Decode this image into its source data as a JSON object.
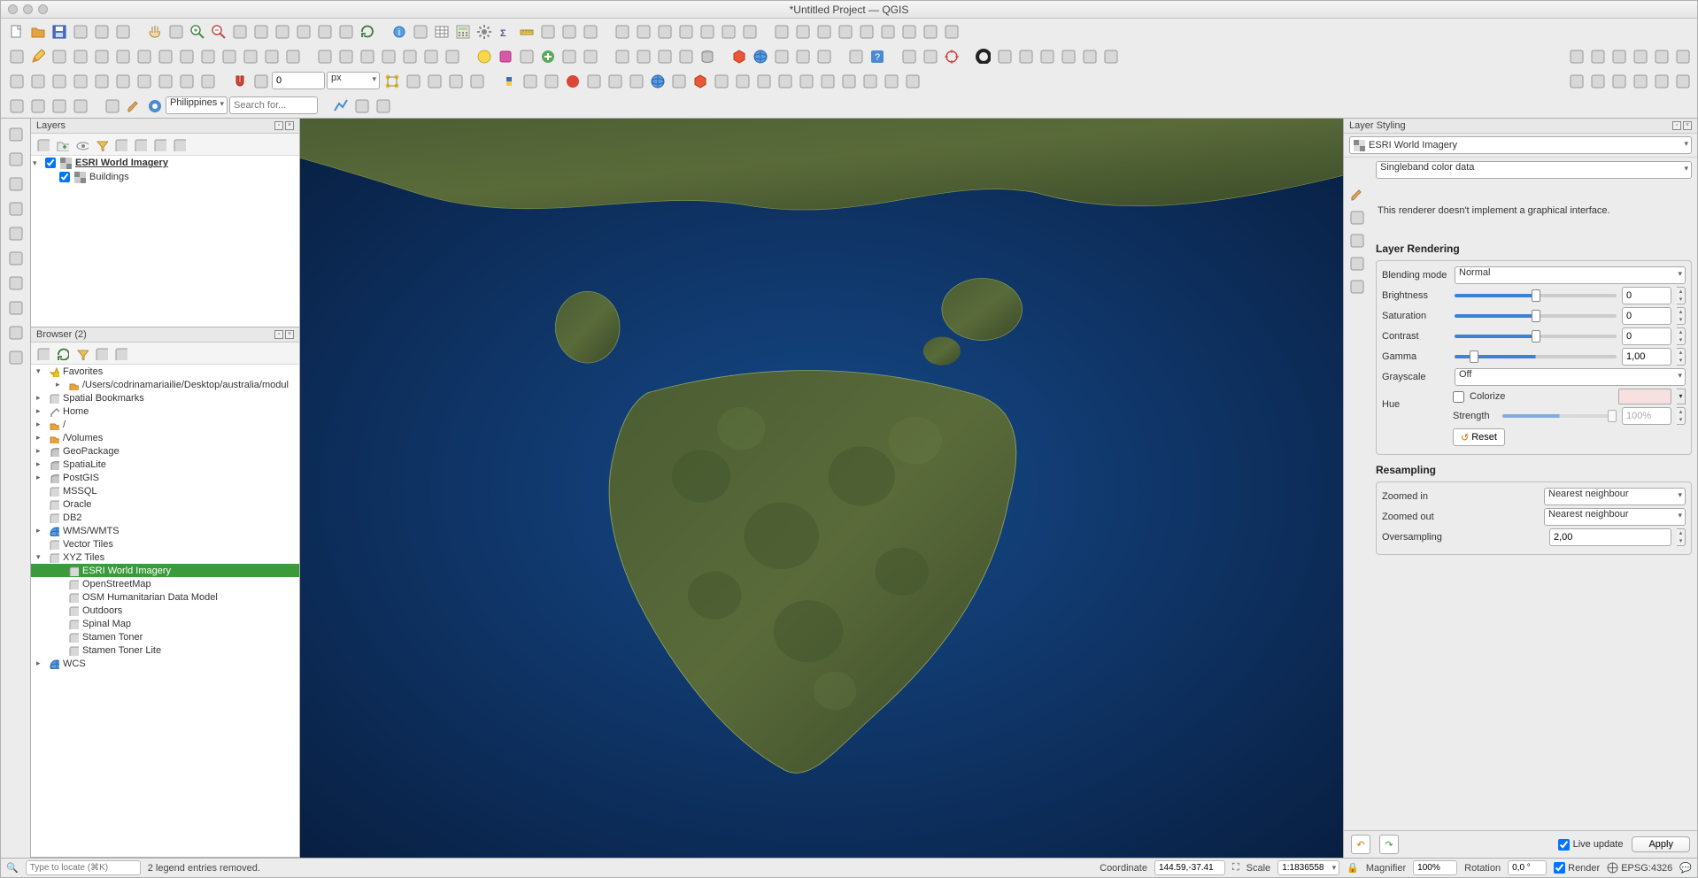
{
  "window": {
    "title": "*Untitled Project — QGIS"
  },
  "toolbar4": {
    "search_placeholder": "Search for...",
    "region": "Philippines",
    "number": "0",
    "unit": "px"
  },
  "layers_panel": {
    "title": "Layers",
    "items": [
      {
        "name": "ESRI World Imagery",
        "checked": true,
        "bold": true
      },
      {
        "name": "Buildings",
        "checked": true,
        "bold": false
      }
    ]
  },
  "browser_panel": {
    "title": "Browser (2)",
    "tree": [
      {
        "label": "Favorites",
        "depth": 0,
        "arrow": "▾",
        "icon": "star"
      },
      {
        "label": "/Users/codrinamariailie/Desktop/australia/modul",
        "depth": 1,
        "arrow": "▸",
        "icon": "folder"
      },
      {
        "label": "Spatial Bookmarks",
        "depth": 0,
        "arrow": "▸",
        "icon": "bookmark"
      },
      {
        "label": "Home",
        "depth": 0,
        "arrow": "▸",
        "icon": "home"
      },
      {
        "label": "/",
        "depth": 0,
        "arrow": "▸",
        "icon": "folder"
      },
      {
        "label": "/Volumes",
        "depth": 0,
        "arrow": "▸",
        "icon": "folder"
      },
      {
        "label": "GeoPackage",
        "depth": 0,
        "arrow": "▸",
        "icon": "db"
      },
      {
        "label": "SpatiaLite",
        "depth": 0,
        "arrow": "▸",
        "icon": "db"
      },
      {
        "label": "PostGIS",
        "depth": 0,
        "arrow": "▸",
        "icon": "postgis"
      },
      {
        "label": "MSSQL",
        "depth": 0,
        "arrow": "",
        "icon": "mssql"
      },
      {
        "label": "Oracle",
        "depth": 0,
        "arrow": "",
        "icon": "oracle"
      },
      {
        "label": "DB2",
        "depth": 0,
        "arrow": "",
        "icon": "db2"
      },
      {
        "label": "WMS/WMTS",
        "depth": 0,
        "arrow": "▸",
        "icon": "globe"
      },
      {
        "label": "Vector Tiles",
        "depth": 0,
        "arrow": "",
        "icon": "tiles"
      },
      {
        "label": "XYZ Tiles",
        "depth": 0,
        "arrow": "▾",
        "icon": "tiles"
      },
      {
        "label": "ESRI World Imagery",
        "depth": 1,
        "arrow": "",
        "icon": "tiles",
        "selected": true
      },
      {
        "label": "OpenStreetMap",
        "depth": 1,
        "arrow": "",
        "icon": "tiles"
      },
      {
        "label": "OSM Humanitarian Data Model",
        "depth": 1,
        "arrow": "",
        "icon": "tiles"
      },
      {
        "label": "Outdoors",
        "depth": 1,
        "arrow": "",
        "icon": "tiles"
      },
      {
        "label": "Spinal Map",
        "depth": 1,
        "arrow": "",
        "icon": "tiles"
      },
      {
        "label": "Stamen Toner",
        "depth": 1,
        "arrow": "",
        "icon": "tiles"
      },
      {
        "label": "Stamen Toner Lite",
        "depth": 1,
        "arrow": "",
        "icon": "tiles"
      },
      {
        "label": "WCS",
        "depth": 0,
        "arrow": "▸",
        "icon": "globe"
      }
    ]
  },
  "styling_panel": {
    "title": "Layer Styling",
    "layer": "ESRI World Imagery",
    "renderer_type": "Singleband color data",
    "renderer_msg": "This renderer doesn't implement a graphical interface.",
    "rendering_heading": "Layer Rendering",
    "blending_label": "Blending mode",
    "blending": "Normal",
    "brightness_label": "Brightness",
    "brightness": "0",
    "saturation_label": "Saturation",
    "saturation": "0",
    "contrast_label": "Contrast",
    "contrast": "0",
    "gamma_label": "Gamma",
    "gamma": "1,00",
    "grayscale_label": "Grayscale",
    "grayscale": "Off",
    "hue_label": "Hue",
    "colorize_label": "Colorize",
    "strength_label": "Strength",
    "strength": "100%",
    "reset_label": "Reset",
    "resampling_heading": "Resampling",
    "zoomed_in_label": "Zoomed in",
    "zoomed_in": "Nearest neighbour",
    "zoomed_out_label": "Zoomed out",
    "zoomed_out": "Nearest neighbour",
    "oversampling_label": "Oversampling",
    "oversampling": "2,00",
    "live_update": "Live update",
    "apply": "Apply"
  },
  "statusbar": {
    "locate_placeholder": "Type to locate (⌘K)",
    "message": "2 legend entries removed.",
    "coord_label": "Coordinate",
    "coord": "144.59,-37.41",
    "scale_label": "Scale",
    "scale": "1:1836558",
    "magnifier_label": "Magnifier",
    "magnifier": "100%",
    "rotation_label": "Rotation",
    "rotation": "0,0 °",
    "render": "Render",
    "crs": "EPSG:4326"
  }
}
